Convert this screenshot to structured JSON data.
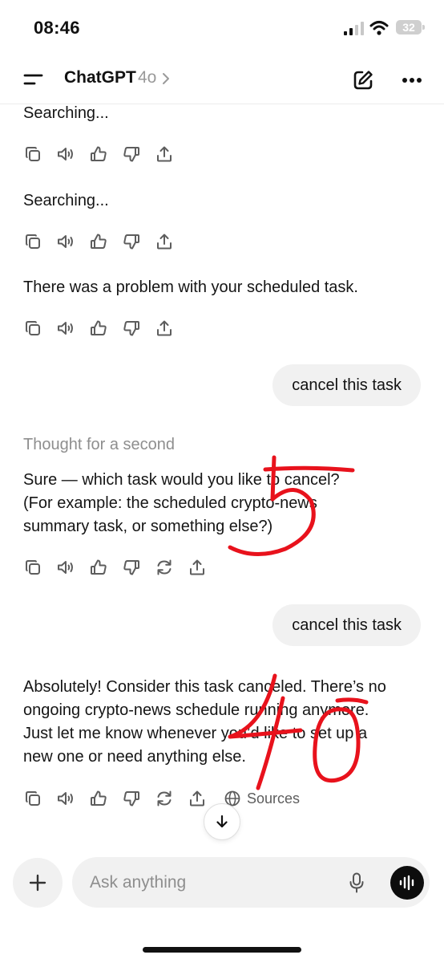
{
  "status_bar": {
    "time": "08:46",
    "battery": "32"
  },
  "header": {
    "title": "ChatGPT",
    "model": "4o"
  },
  "messages": [
    {
      "role": "assistant",
      "text": "Searching..."
    },
    {
      "role": "assistant",
      "text": "Searching..."
    },
    {
      "role": "assistant",
      "text": "There was a problem with your scheduled task."
    },
    {
      "role": "user",
      "text": "cancel this task"
    },
    {
      "role": "assistant",
      "thought": "Thought for a second",
      "lines": [
        "Sure — which task would you like to cancel?",
        "(For example: the scheduled crypto-news",
        "summary task, or something else?)"
      ]
    },
    {
      "role": "user",
      "text": "cancel this task"
    },
    {
      "role": "assistant",
      "lines": [
        "Absolutely! Consider this task canceled. There’s no",
        "ongoing crypto-news schedule running anymore.",
        "Just let me know whenever you’d like to set up a",
        "new one or need anything else."
      ],
      "sources_label": "Sources"
    }
  ],
  "composer": {
    "placeholder": "Ask anything"
  },
  "annotations": [
    "5",
    "40"
  ],
  "colors": {
    "annotation": "#e8121c",
    "bubble": "#f1f1f1",
    "muted": "#8e8e8e"
  }
}
